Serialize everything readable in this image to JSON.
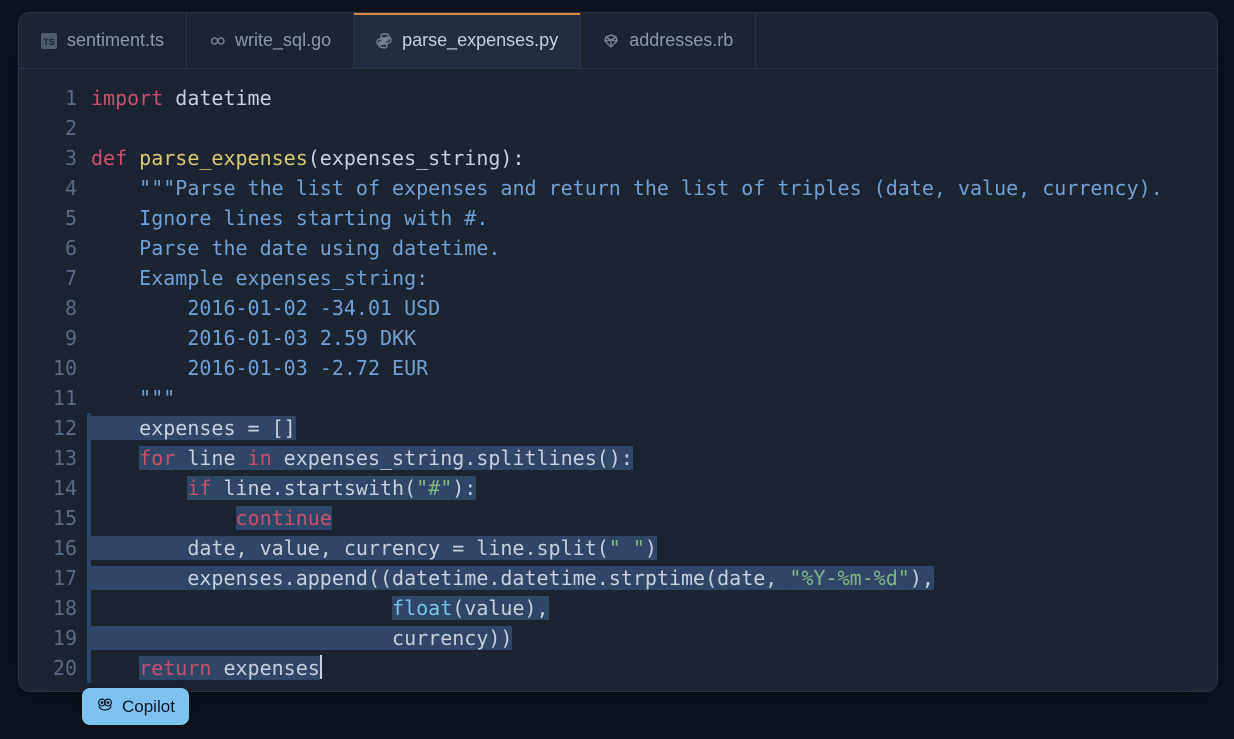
{
  "tabs": [
    {
      "label": "sentiment.ts",
      "icon": "ts-file-icon",
      "active": false
    },
    {
      "label": "write_sql.go",
      "icon": "go-file-icon",
      "active": false
    },
    {
      "label": "parse_expenses.py",
      "icon": "python-file-icon",
      "active": true
    },
    {
      "label": "addresses.rb",
      "icon": "ruby-file-icon",
      "active": false
    }
  ],
  "copilot": {
    "label": "Copilot"
  },
  "code": {
    "lines": [
      {
        "n": 1,
        "tokens": [
          [
            "kw",
            "import"
          ],
          [
            "txt",
            " datetime"
          ]
        ]
      },
      {
        "n": 2,
        "tokens": []
      },
      {
        "n": 3,
        "tokens": [
          [
            "kw",
            "def "
          ],
          [
            "fn",
            "parse_expenses"
          ],
          [
            "txt",
            "(expenses_string):"
          ]
        ]
      },
      {
        "n": 4,
        "tokens": [
          [
            "txt",
            "    "
          ],
          [
            "doc",
            "\"\"\"Parse the list of expenses and return the list of triples (date, value, currency)."
          ]
        ]
      },
      {
        "n": 5,
        "tokens": [
          [
            "txt",
            "    "
          ],
          [
            "doc",
            "Ignore lines starting with #."
          ]
        ]
      },
      {
        "n": 6,
        "tokens": [
          [
            "txt",
            "    "
          ],
          [
            "doc",
            "Parse the date using datetime."
          ]
        ]
      },
      {
        "n": 7,
        "tokens": [
          [
            "txt",
            "    "
          ],
          [
            "doc",
            "Example expenses_string:"
          ]
        ]
      },
      {
        "n": 8,
        "tokens": [
          [
            "txt",
            "    "
          ],
          [
            "doc",
            "    2016-01-02 -34.01 USD"
          ]
        ]
      },
      {
        "n": 9,
        "tokens": [
          [
            "txt",
            "    "
          ],
          [
            "doc",
            "    2016-01-03 2.59 DKK"
          ]
        ]
      },
      {
        "n": 10,
        "tokens": [
          [
            "txt",
            "    "
          ],
          [
            "doc",
            "    2016-01-03 -2.72 EUR"
          ]
        ]
      },
      {
        "n": 11,
        "tokens": [
          [
            "txt",
            "    "
          ],
          [
            "doc",
            "\"\"\""
          ]
        ]
      },
      {
        "n": 12,
        "hl": true,
        "tokens": [
          [
            "txt",
            "    expenses = []"
          ]
        ]
      },
      {
        "n": 13,
        "hl": true,
        "tokens": [
          [
            "txt",
            "    "
          ],
          [
            "kw",
            "for"
          ],
          [
            "txt",
            " line "
          ],
          [
            "kw",
            "in"
          ],
          [
            "txt",
            " expenses_string.splitlines():"
          ]
        ]
      },
      {
        "n": 14,
        "hl": true,
        "tokens": [
          [
            "txt",
            "        "
          ],
          [
            "kw",
            "if"
          ],
          [
            "txt",
            " line.startswith("
          ],
          [
            "str",
            "\"#\""
          ],
          [
            "txt",
            "):"
          ]
        ]
      },
      {
        "n": 15,
        "hl": true,
        "tokens": [
          [
            "txt",
            "            "
          ],
          [
            "kw",
            "continue"
          ]
        ]
      },
      {
        "n": 16,
        "hl": true,
        "tokens": [
          [
            "txt",
            "        date, value, currency = line.split("
          ],
          [
            "str",
            "\" \""
          ],
          [
            "txt",
            ")"
          ]
        ]
      },
      {
        "n": 17,
        "hl": true,
        "tokens": [
          [
            "txt",
            "        expenses.append((datetime.datetime.strptime(date, "
          ],
          [
            "str",
            "\"%Y-%m-%d\""
          ],
          [
            "txt",
            "),"
          ]
        ]
      },
      {
        "n": 18,
        "hl": true,
        "tokens": [
          [
            "txt",
            "                         "
          ],
          [
            "builtin",
            "float"
          ],
          [
            "txt",
            "(value),"
          ]
        ]
      },
      {
        "n": 19,
        "hl": true,
        "tokens": [
          [
            "txt",
            "                         currency))"
          ]
        ]
      },
      {
        "n": 20,
        "hl": true,
        "cursor": true,
        "tokens": [
          [
            "txt",
            "    "
          ],
          [
            "kw",
            "return"
          ],
          [
            "txt",
            " expenses"
          ]
        ]
      }
    ]
  }
}
